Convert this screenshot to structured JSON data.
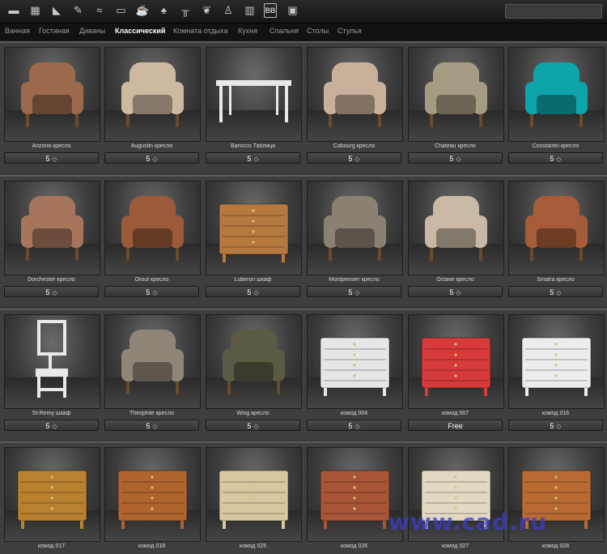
{
  "colors": {
    "accent": "#00a0a8",
    "watermark": "#3c3cc8",
    "free": "#ffffff"
  },
  "toolbar": {
    "icons": [
      "bath-icon",
      "brick-icon",
      "stairs-icon",
      "brush-icon",
      "wave-icon",
      "sofa-icon",
      "cup-icon",
      "lamp-icon",
      "desk-icon",
      "leaf-icon",
      "person-icon",
      "building-icon",
      "bb-icon",
      "picture-icon"
    ],
    "bb_label": "BB"
  },
  "tabs": [
    "Ванная",
    "Гостиная",
    "Диваны",
    "Классический",
    "Комната отдыха",
    "Кухня",
    "Спальня",
    "Столы",
    "Стулья"
  ],
  "active_tab": "Классический",
  "rows": [
    [
      {
        "name": "Arizona кресло",
        "price": "5",
        "gem": true,
        "color": "#9b6a4c",
        "kind": "armchair"
      },
      {
        "name": "Augustin кресло",
        "price": "5",
        "gem": true,
        "color": "#cdb9a0",
        "kind": "armchair"
      },
      {
        "name": "Barocco Таблица",
        "price": "5",
        "gem": true,
        "color": "#e8e8e8",
        "kind": "table"
      },
      {
        "name": "Cabourg кресло",
        "price": "5",
        "gem": true,
        "color": "#c9b09a",
        "kind": "armchair"
      },
      {
        "name": "Chateau кресло",
        "price": "5",
        "gem": true,
        "color": "#a59a82",
        "kind": "armchair"
      },
      {
        "name": "Constantin кресло",
        "price": "5",
        "gem": true,
        "color": "#0da5aa",
        "kind": "armchair"
      }
    ],
    [
      {
        "name": "Dorchester кресло",
        "price": "5",
        "gem": true,
        "color": "#a6765c",
        "kind": "armchair"
      },
      {
        "name": "Orout кресло",
        "price": "5",
        "gem": true,
        "color": "#9b5a3a",
        "kind": "armchair"
      },
      {
        "name": "Luberon шкаф",
        "price": "5",
        "gem": true,
        "color": "#b5783e",
        "kind": "dresser"
      },
      {
        "name": "Montpensier кресло",
        "price": "5",
        "gem": true,
        "color": "#8a8172",
        "kind": "armchair"
      },
      {
        "name": "Octave кресло",
        "price": "5",
        "gem": true,
        "color": "#c8b8a4",
        "kind": "armchair"
      },
      {
        "name": "Sinatra кресло",
        "price": "5",
        "gem": true,
        "color": "#a65c38",
        "kind": "armchair"
      }
    ],
    [
      {
        "name": "St-Remy шкаф",
        "price": "5",
        "gem": true,
        "color": "#e9e9e9",
        "kind": "washstand"
      },
      {
        "name": "Theophile кресло",
        "price": "5",
        "gem": true,
        "color": "#8f8677",
        "kind": "armchair"
      },
      {
        "name": "Wing кресло",
        "price": "5",
        "gem": true,
        "color": "#5c5a45",
        "kind": "armchair"
      },
      {
        "name": "комод 004",
        "price": "5",
        "gem": true,
        "color": "#e6e6e6",
        "kind": "dresser"
      },
      {
        "name": "комод 007",
        "price": "Free",
        "gem": false,
        "color": "#d63a3a",
        "kind": "dresser"
      },
      {
        "name": "комод 016",
        "price": "5",
        "gem": true,
        "color": "#ececec",
        "kind": "dresser"
      }
    ],
    [
      {
        "name": "комод 017",
        "price": "",
        "gem": false,
        "color": "#b8812f",
        "kind": "dresser"
      },
      {
        "name": "комод 018",
        "price": "",
        "gem": false,
        "color": "#b0642d",
        "kind": "dresser"
      },
      {
        "name": "комод 025",
        "price": "",
        "gem": false,
        "color": "#d8c7a0",
        "kind": "dresser"
      },
      {
        "name": "комод 026",
        "price": "",
        "gem": false,
        "color": "#a85436",
        "kind": "dresser"
      },
      {
        "name": "комод 027",
        "price": "",
        "gem": false,
        "color": "#e3d8c2",
        "kind": "dresser"
      },
      {
        "name": "комод 028",
        "price": "",
        "gem": false,
        "color": "#b96a32",
        "kind": "dresser"
      }
    ]
  ],
  "watermark": "www.cad.ru"
}
